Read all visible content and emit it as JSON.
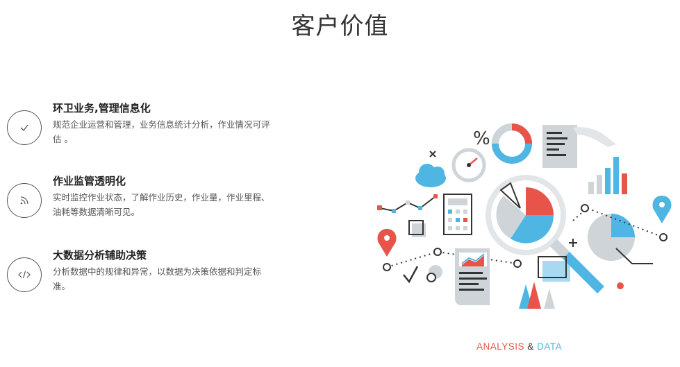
{
  "page": {
    "title": "客户价值"
  },
  "features": [
    {
      "title": "环卫业务,管理信息化",
      "desc": "规范企业运营和管理，业务信息统计分析，作业情况可评估 。",
      "icon": "check-icon"
    },
    {
      "title": "作业监管透明化",
      "desc": "实时监控作业状态，了解作业历史，作业量，作业里程、油耗等数据清晰可见。",
      "icon": "signal-icon"
    },
    {
      "title": "大数据分析辅助决策",
      "desc": "分析数据中的规律和异常，以数据为决策依据和判定标准。",
      "icon": "code-icon"
    }
  ],
  "illustration": {
    "part1": "ANALYSIS",
    "amp": "&",
    "part2": "DATA"
  },
  "colors": {
    "red": "#e8534a",
    "blue": "#4fb6e3",
    "gray": "#cfd4d8",
    "dark": "#333333"
  }
}
